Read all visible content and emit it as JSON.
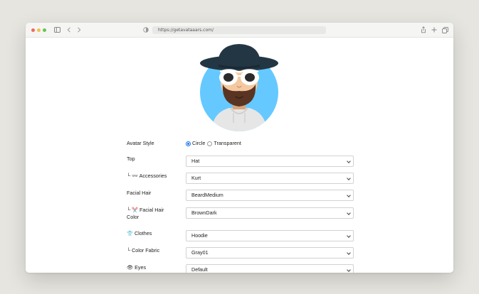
{
  "browser": {
    "url": "https://getavataaars.com/"
  },
  "avatar": {
    "background_color": "#65c9ff",
    "skin_color": "#f4c9a0",
    "hair_color": "#5a3423",
    "hat_color": "#233643",
    "hoodie_color": "#e6e6e6"
  },
  "form": {
    "avatar_style": {
      "label": "Avatar Style",
      "options": [
        "Circle",
        "Transparent"
      ],
      "selected": "Circle"
    },
    "rows": [
      {
        "label": "Top",
        "value": "Hat",
        "icon": ""
      },
      {
        "label": "└ 👓 Accessories",
        "value": "Kurt",
        "icon": ""
      },
      {
        "label": "Facial Hair",
        "value": "BeardMedium",
        "icon": ""
      },
      {
        "label": "└ ✂️ Facial Hair Color",
        "value": "BrownDark",
        "icon": ""
      },
      {
        "label": "👕 Clothes",
        "value": "Hoodie",
        "icon": ""
      },
      {
        "label": "└ Color Fabric",
        "value": "Gray01",
        "icon": ""
      },
      {
        "label": "👁 Eyes",
        "value": "Default",
        "icon": ""
      }
    ]
  }
}
